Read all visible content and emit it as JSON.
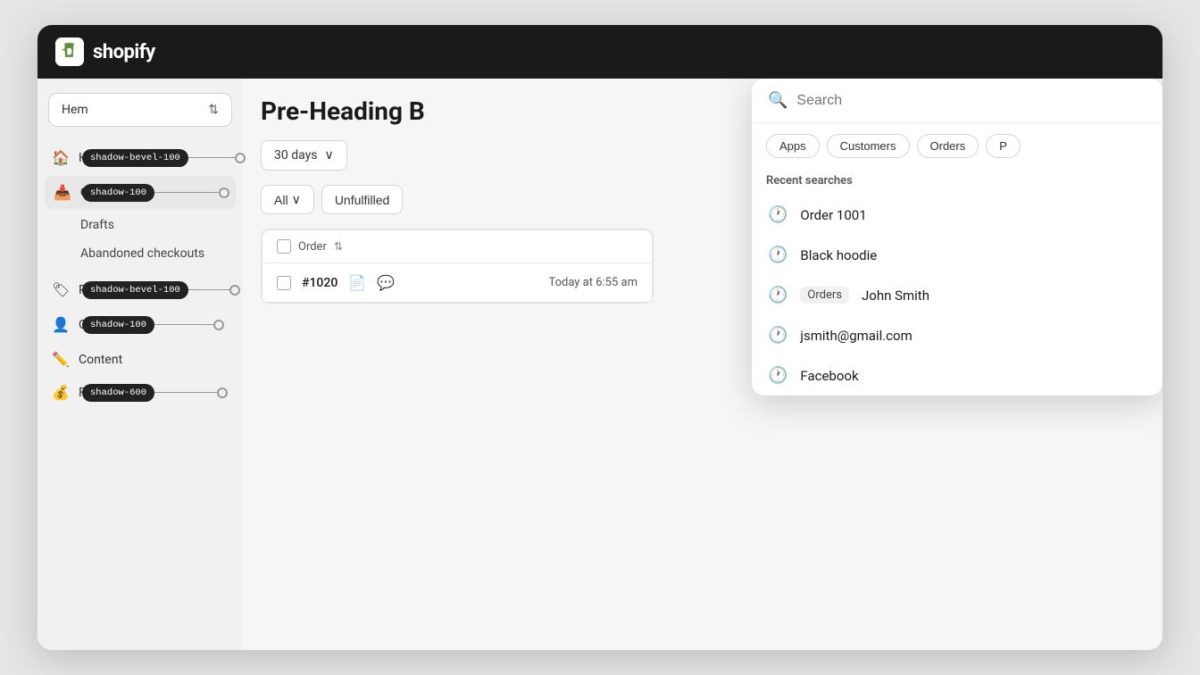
{
  "topNav": {
    "logoText": "shopify",
    "searchPlaceholder": "Search"
  },
  "sidebar": {
    "storeSelector": {
      "label": "Hem",
      "chevron": "⇅"
    },
    "navItems": [
      {
        "id": "home",
        "icon": "🏠",
        "label": "Home",
        "active": false,
        "badge": "shadow-bevel-100"
      },
      {
        "id": "orders",
        "icon": "📥",
        "label": "Orders",
        "active": true,
        "badge": "shadow-100"
      },
      {
        "id": "drafts",
        "icon": "",
        "label": "Drafts",
        "active": false,
        "indent": true
      },
      {
        "id": "abandoned",
        "icon": "",
        "label": "Abandoned checkouts",
        "active": false,
        "indent": true
      },
      {
        "id": "products",
        "icon": "🏷",
        "label": "Products",
        "active": false,
        "badge": "shadow-bevel-100"
      },
      {
        "id": "customers",
        "icon": "👤",
        "label": "Customers",
        "active": false,
        "badge": "shadow-100"
      },
      {
        "id": "content",
        "icon": "✏️",
        "label": "Content",
        "active": false
      },
      {
        "id": "finances",
        "icon": "💰",
        "label": "Finances",
        "active": false,
        "badge": "shadow-600"
      }
    ]
  },
  "content": {
    "heading": "Pre-Heading B",
    "dateFilter": "30 days",
    "filterAll": "All",
    "filterUnfulfilled": "Unfulfilled",
    "tableHeader": "Order",
    "tableRow": {
      "orderNum": "#1020",
      "timestamp": "Today at 6:55 am"
    }
  },
  "searchOverlay": {
    "inputValue": "",
    "placeholder": "Search",
    "categories": [
      "Apps",
      "Customers",
      "Orders",
      "P"
    ],
    "recentSearchesLabel": "Recent searches",
    "recentItems": [
      {
        "id": "order1001",
        "text": "Order 1001",
        "badge": null
      },
      {
        "id": "blackhoodie",
        "text": "Black hoodie",
        "badge": null
      },
      {
        "id": "johnsmith",
        "text": "John Smith",
        "badge": "Orders"
      },
      {
        "id": "jsmith",
        "text": "jsmith@gmail.com",
        "badge": null
      },
      {
        "id": "facebook",
        "text": "Facebook",
        "badge": null
      }
    ]
  }
}
